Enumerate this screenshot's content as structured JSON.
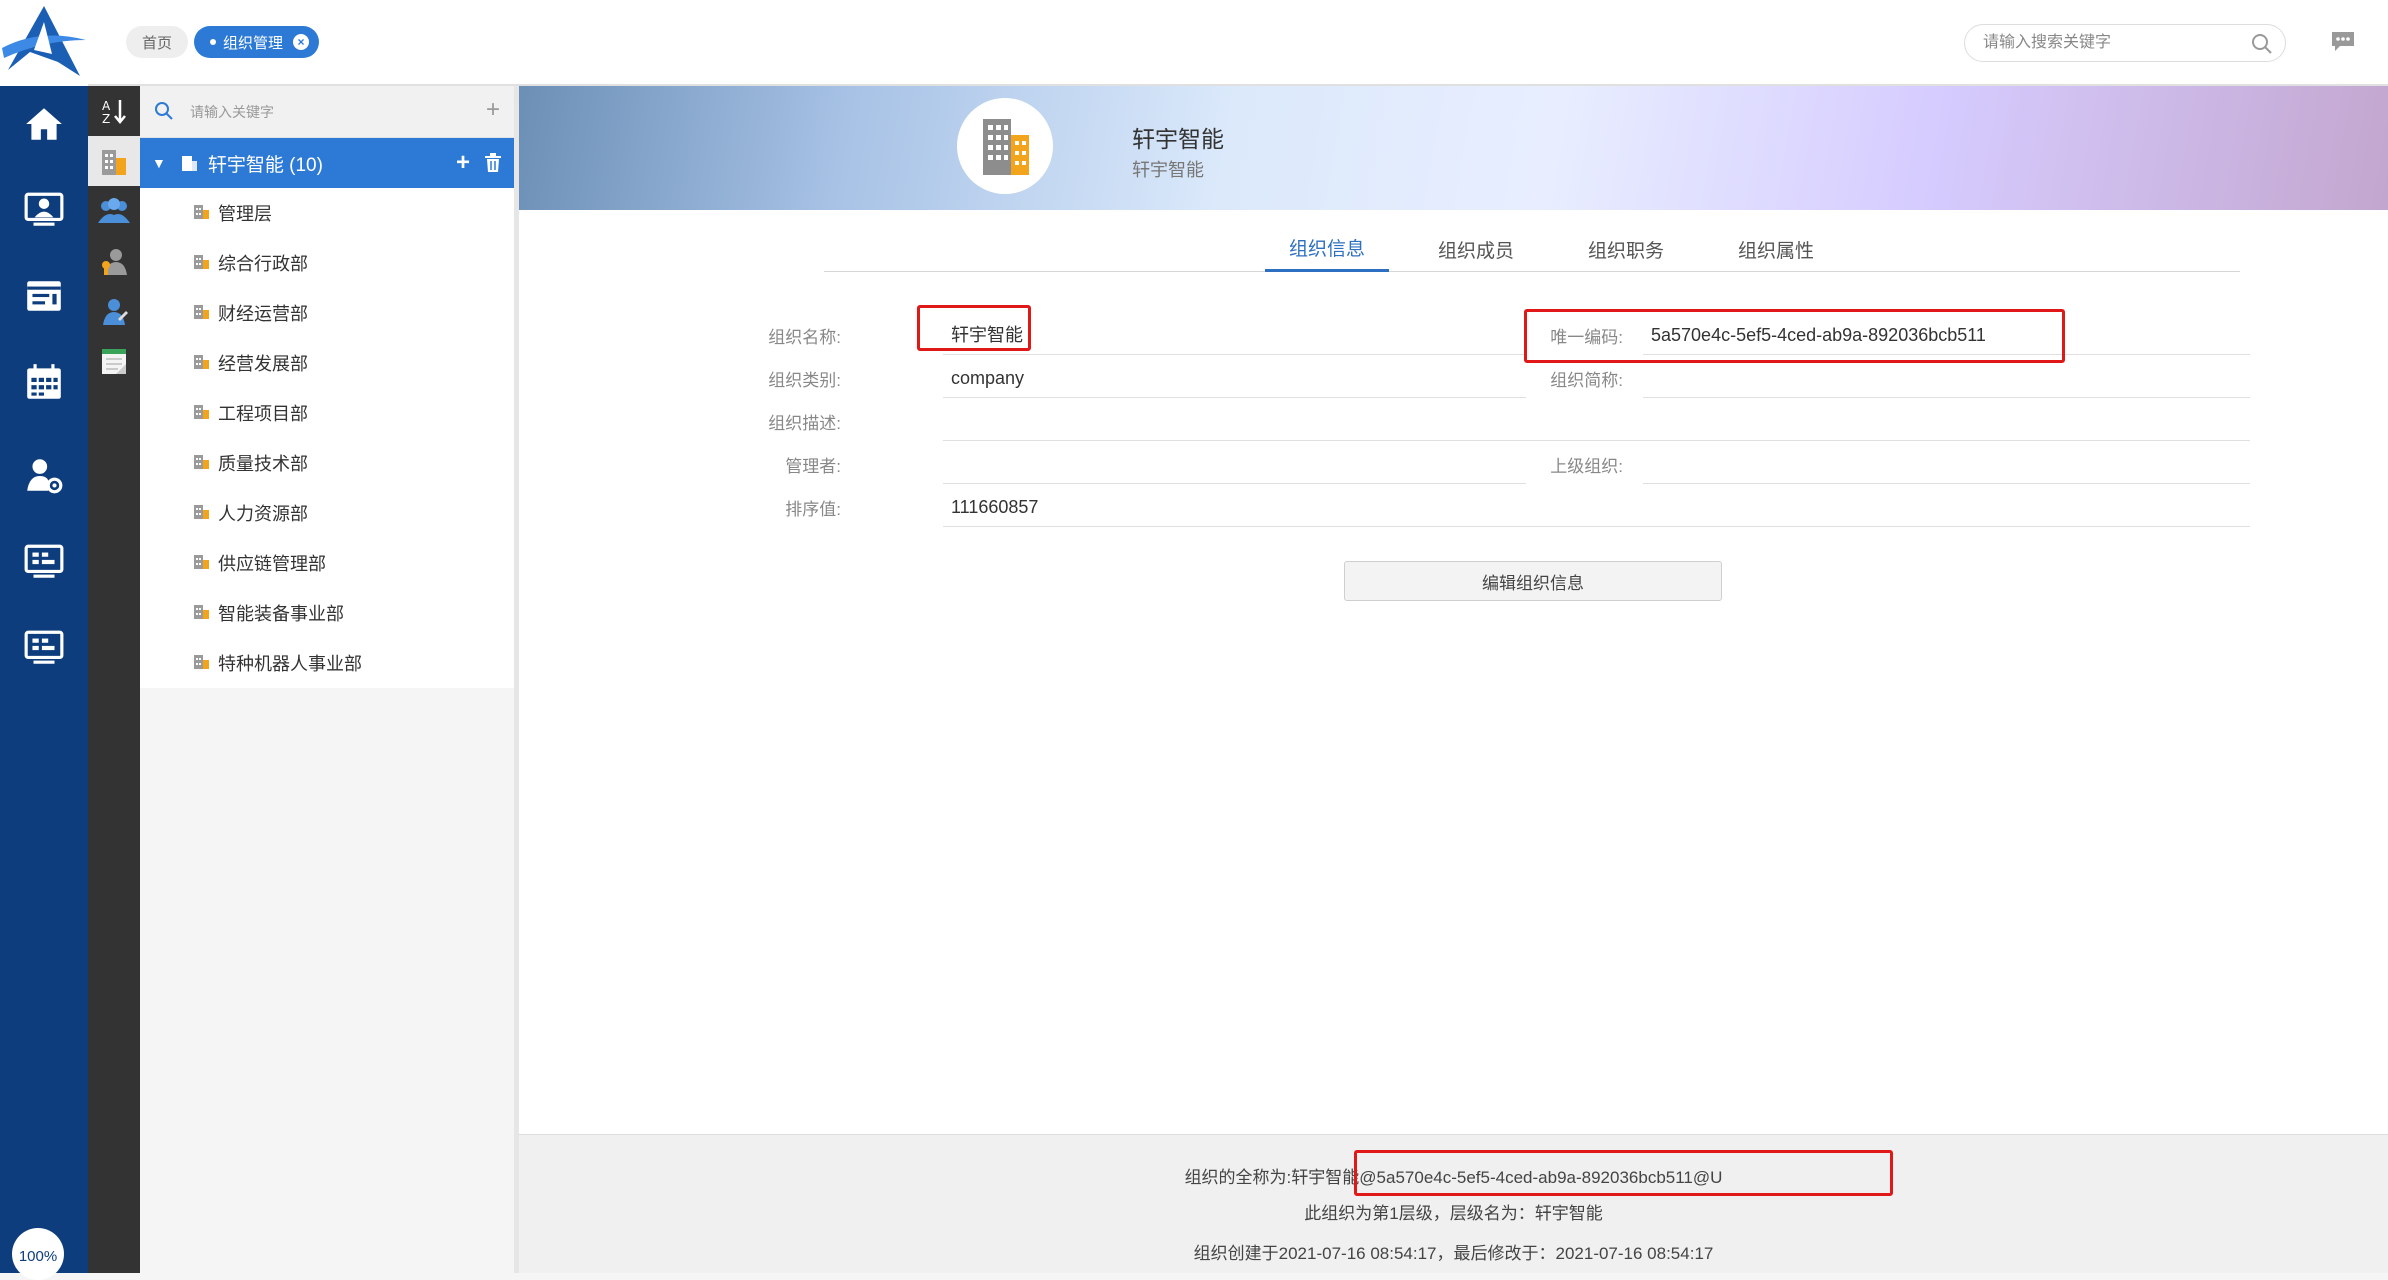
{
  "app": {
    "zoom": "100%"
  },
  "rail": {
    "items": [
      "home-icon",
      "screen-user-icon",
      "calendar-list-icon",
      "calendar-grid-icon",
      "user-settings-icon",
      "dashboard-icon",
      "dashboard-icon-2"
    ]
  },
  "header": {
    "tabs": [
      {
        "label": "首页"
      },
      {
        "label": "组织管理"
      }
    ],
    "search": {
      "placeholder": "请输入搜索关键字"
    }
  },
  "tree": {
    "search_placeholder": "请输入关键字",
    "root": {
      "label": "轩宇智能 (10)"
    },
    "children": [
      "管理层",
      "综合行政部",
      "财经运营部",
      "经营发展部",
      "工程项目部",
      "质量技术部",
      "人力资源部",
      "供应链管理部",
      "智能装备事业部",
      "特种机器人事业部"
    ]
  },
  "org": {
    "title": "轩宇智能",
    "subtitle": "轩宇智能"
  },
  "tabs": [
    "组织信息",
    "组织成员",
    "组织职务",
    "组织属性"
  ],
  "fields": {
    "name": {
      "label": "组织名称:",
      "value": "轩宇智能"
    },
    "unique_code": {
      "label": "唯一编码:",
      "value": "5a570e4c-5ef5-4ced-ab9a-892036bcb511"
    },
    "type": {
      "label": "组织类别:",
      "value": "company"
    },
    "short_name": {
      "label": "组织简称:",
      "value": ""
    },
    "description": {
      "label": "组织描述:",
      "value": ""
    },
    "manager": {
      "label": "管理者:",
      "value": ""
    },
    "parent": {
      "label": "上级组织:",
      "value": ""
    },
    "sort": {
      "label": "排序值:",
      "value": "111660857"
    }
  },
  "edit_button": "编辑组织信息",
  "footer": {
    "fullname_label": "组织的全称为:",
    "fullname_value": "轩宇智能@5a570e4c-5ef5-4ced-ab9a-892036bcb511@U",
    "level_line": "此组织为第1层级，层级名为：轩宇智能",
    "dates_line": "组织创建于2021-07-16 08:54:17，最后修改于：2021-07-16 08:54:17"
  },
  "colors": {
    "accent": "#2d7ad6",
    "rail": "#0e3d7e",
    "highlight": "#e01818"
  }
}
